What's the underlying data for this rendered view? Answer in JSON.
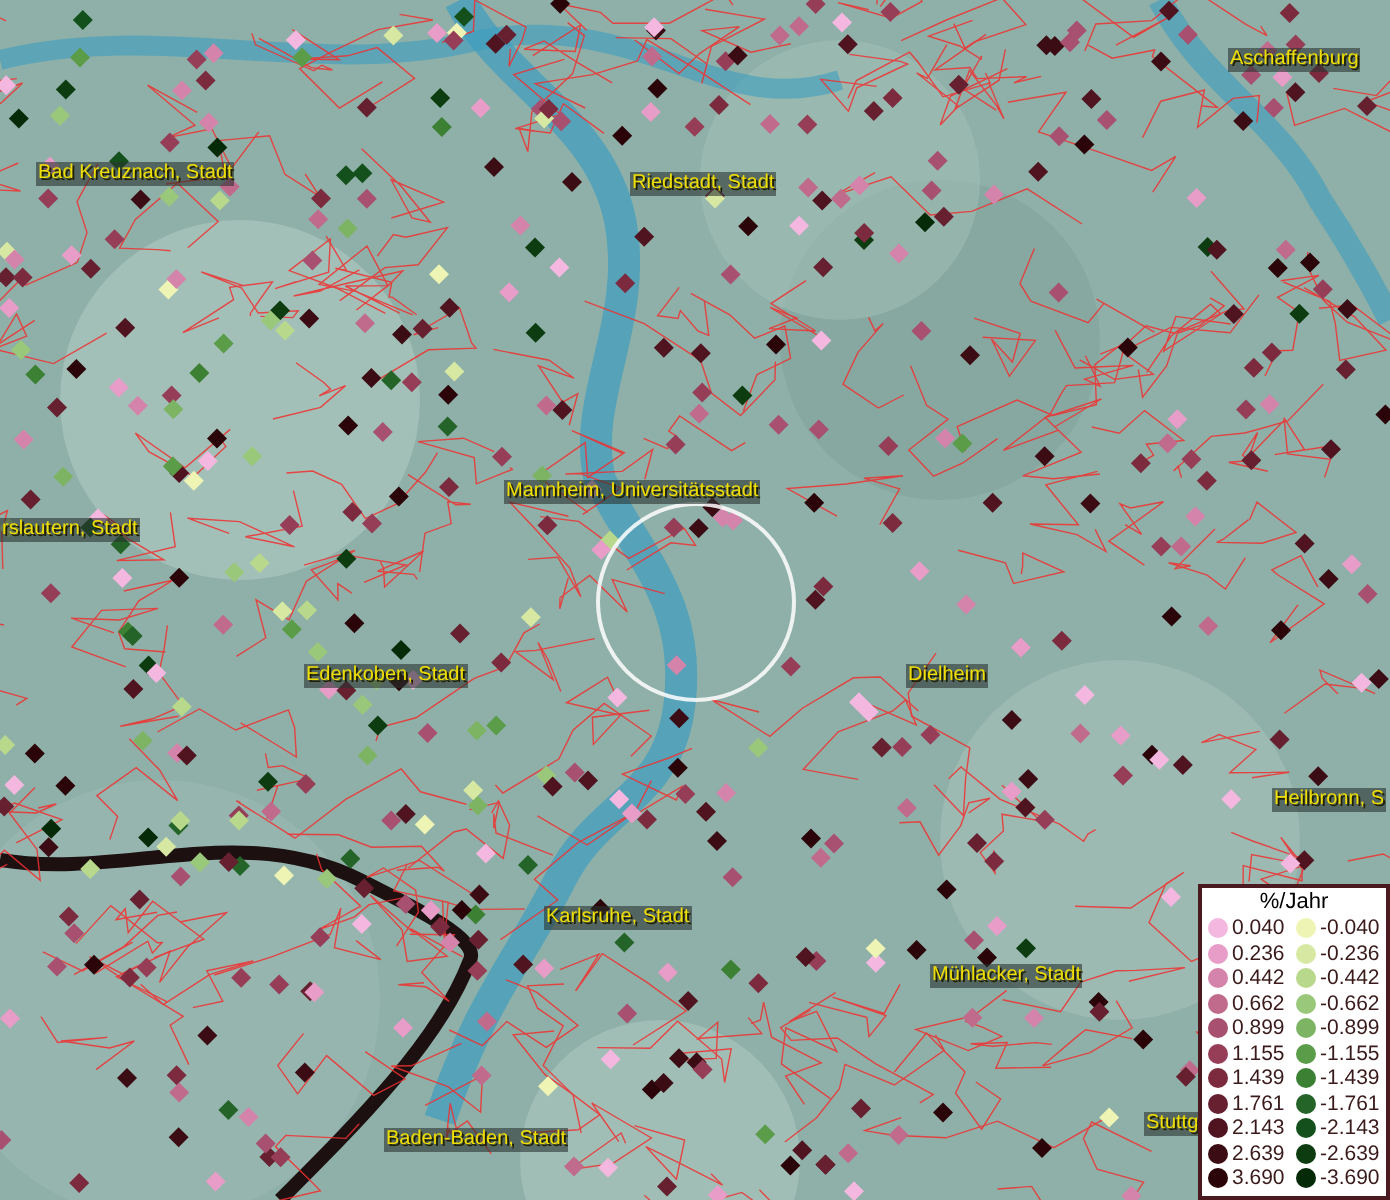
{
  "map": {
    "places": [
      {
        "name": "Aschaffenburg"
      },
      {
        "name": "Bad Kreuznach, Stadt"
      },
      {
        "name": "Riedstadt, Stadt"
      },
      {
        "name": "Mannheim, Universitätsstadt"
      },
      {
        "name": "rslautern, Stadt"
      },
      {
        "name": "Edenkoben, Stadt"
      },
      {
        "name": "Dielheim"
      },
      {
        "name": "Heilbronn, S"
      },
      {
        "name": "Karlsruhe, Stadt"
      },
      {
        "name": "Mühlacker, Stadt"
      },
      {
        "name": "Baden-Baden, Stadt"
      },
      {
        "name": "Stuttg"
      }
    ]
  },
  "legend": {
    "title": "%/Jahr",
    "rows": [
      {
        "positive": {
          "label": "0.040",
          "color": "#f4b8e0"
        },
        "negative": {
          "label": "-0.040",
          "color": "#eef4b4"
        }
      },
      {
        "positive": {
          "label": "0.236",
          "color": "#e89cc8"
        },
        "negative": {
          "label": "-0.236",
          "color": "#d6e8a2"
        }
      },
      {
        "positive": {
          "label": "0.442",
          "color": "#d484aa"
        },
        "negative": {
          "label": "-0.442",
          "color": "#b8d88c"
        }
      },
      {
        "positive": {
          "label": "0.662",
          "color": "#c06a8c"
        },
        "negative": {
          "label": "-0.662",
          "color": "#9ac87a"
        }
      },
      {
        "positive": {
          "label": "0.899",
          "color": "#a85070"
        },
        "negative": {
          "label": "-0.899",
          "color": "#7cb464"
        }
      },
      {
        "positive": {
          "label": "1.155",
          "color": "#963e58"
        },
        "negative": {
          "label": "-1.155",
          "color": "#5a9c48"
        }
      },
      {
        "positive": {
          "label": "1.439",
          "color": "#7c2a3e"
        },
        "negative": {
          "label": "-1.439",
          "color": "#3c8034"
        }
      },
      {
        "positive": {
          "label": "1.761",
          "color": "#662030"
        },
        "negative": {
          "label": "-1.761",
          "color": "#246428"
        }
      },
      {
        "positive": {
          "label": "2.143",
          "color": "#501420"
        },
        "negative": {
          "label": "-2.143",
          "color": "#14501c"
        }
      },
      {
        "positive": {
          "label": "2.639",
          "color": "#3c0c14"
        },
        "negative": {
          "label": "-2.639",
          "color": "#0c3c10"
        }
      },
      {
        "positive": {
          "label": "3.690",
          "color": "#2a0408"
        },
        "negative": {
          "label": "-3.690",
          "color": "#042a08"
        }
      }
    ]
  }
}
